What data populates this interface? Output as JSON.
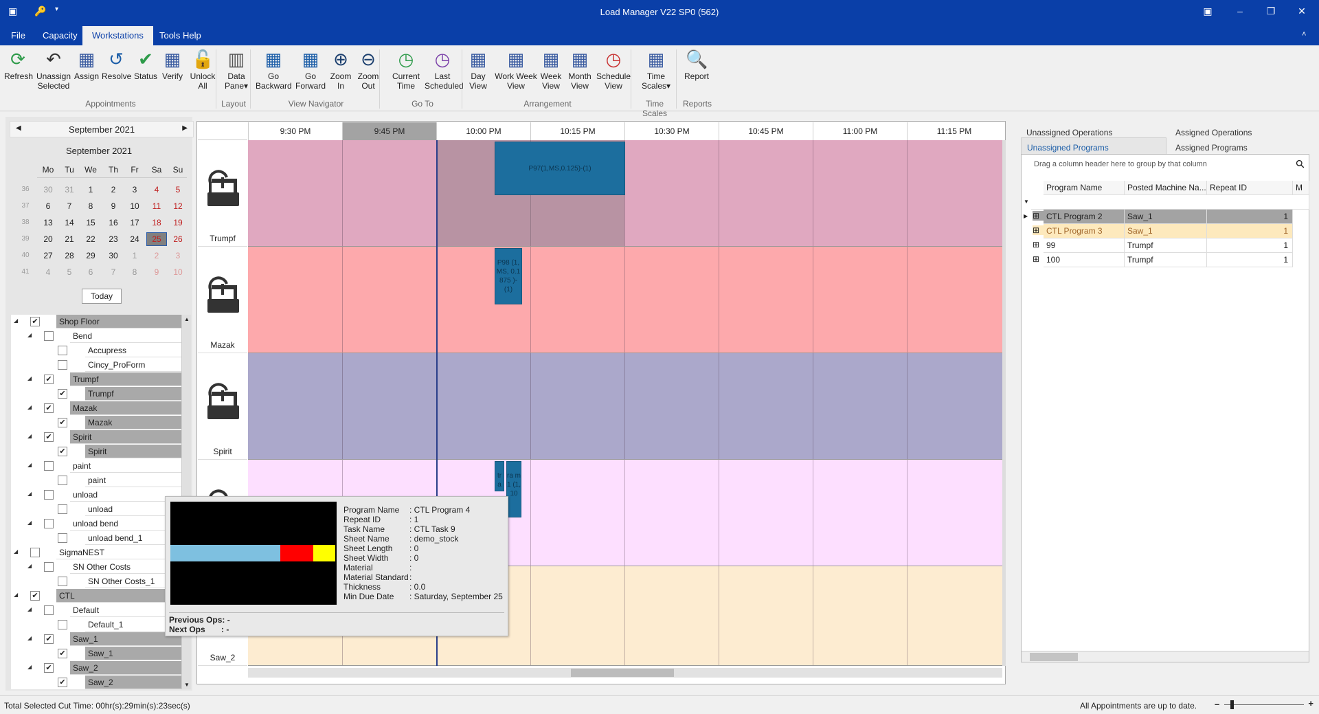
{
  "window": {
    "title": "Load Manager V22 SP0 (562)"
  },
  "menu": [
    "File",
    "Capacity",
    "Workstations",
    "Tools Help"
  ],
  "ribbon": {
    "buttons": [
      {
        "id": "refresh",
        "label": "Refresh",
        "icon": "refresh-icon"
      },
      {
        "id": "unassign",
        "label": "Unassign\nSelected",
        "icon": "undo-icon"
      },
      {
        "id": "assign",
        "label": "Assign",
        "icon": "calendar-bolt-icon"
      },
      {
        "id": "resolve",
        "label": "Resolve",
        "icon": "resolve-icon"
      },
      {
        "id": "status",
        "label": "Status",
        "icon": "check-circle-icon"
      },
      {
        "id": "verify",
        "label": "Verify",
        "icon": "calendar-binoculars-icon"
      },
      {
        "id": "unlock",
        "label": "Unlock\nAll",
        "icon": "unlock-icon"
      },
      {
        "id": "datapane",
        "label": "Data\nPane▾",
        "icon": "pane-icon"
      },
      {
        "id": "gobackward",
        "label": "Go\nBackward",
        "icon": "calendar-back-icon"
      },
      {
        "id": "goforward",
        "label": "Go\nForward",
        "icon": "calendar-forward-icon"
      },
      {
        "id": "zoomin",
        "label": "Zoom\nIn",
        "icon": "zoom-in-icon"
      },
      {
        "id": "zoomout",
        "label": "Zoom\nOut",
        "icon": "zoom-out-icon"
      },
      {
        "id": "currenttime",
        "label": "Current\nTime",
        "icon": "clock-arrow-icon"
      },
      {
        "id": "lastscheduled",
        "label": "Last\nScheduled",
        "icon": "clock-forward-icon"
      },
      {
        "id": "dayview",
        "label": "Day\nView",
        "icon": "calendar-day-icon"
      },
      {
        "id": "workweekview",
        "label": "Work Week\nView",
        "icon": "calendar-workweek-icon"
      },
      {
        "id": "weekview",
        "label": "Week\nView",
        "icon": "calendar-week-icon"
      },
      {
        "id": "monthview",
        "label": "Month\nView",
        "icon": "calendar-month-icon"
      },
      {
        "id": "scheduleview",
        "label": "Schedule\nView",
        "icon": "timeline-clock-icon"
      },
      {
        "id": "timescales",
        "label": "Time\nScales▾",
        "icon": "calendar-clock-icon"
      },
      {
        "id": "report",
        "label": "Report",
        "icon": "report-icon"
      }
    ],
    "groups": [
      "Appointments",
      "Layout",
      "View Navigator",
      "Go To",
      "Arrangement",
      "Time Scales",
      "Reports"
    ]
  },
  "calendar": {
    "nav_title": "September 2021",
    "title": "September 2021",
    "weekdays": [
      "Mo",
      "Tu",
      "We",
      "Th",
      "Fr",
      "Sa",
      "Su"
    ],
    "weeks": [
      {
        "wk": "36",
        "days": [
          "30",
          "31",
          "1",
          "2",
          "3",
          "4",
          "5"
        ]
      },
      {
        "wk": "37",
        "days": [
          "6",
          "7",
          "8",
          "9",
          "10",
          "11",
          "12"
        ]
      },
      {
        "wk": "38",
        "days": [
          "13",
          "14",
          "15",
          "16",
          "17",
          "18",
          "19"
        ]
      },
      {
        "wk": "39",
        "days": [
          "20",
          "21",
          "22",
          "23",
          "24",
          "25",
          "26"
        ]
      },
      {
        "wk": "40",
        "days": [
          "27",
          "28",
          "29",
          "30",
          "1",
          "2",
          "3"
        ]
      },
      {
        "wk": "41",
        "days": [
          "4",
          "5",
          "6",
          "7",
          "8",
          "9",
          "10"
        ]
      }
    ],
    "selected": "25",
    "today_label": "Today"
  },
  "tree": [
    {
      "label": "Shop Floor",
      "level": 0,
      "checked": true,
      "expand": true,
      "sel": true
    },
    {
      "label": "Bend",
      "level": 1,
      "checked": false,
      "expand": true,
      "sel": false
    },
    {
      "label": "Accupress",
      "level": 2,
      "checked": false,
      "expand": false,
      "sel": false
    },
    {
      "label": "Cincy_ProForm",
      "level": 2,
      "checked": false,
      "expand": false,
      "sel": false
    },
    {
      "label": "Trumpf",
      "level": 1,
      "checked": true,
      "expand": true,
      "sel": true
    },
    {
      "label": "Trumpf",
      "level": 2,
      "checked": true,
      "expand": false,
      "sel": true
    },
    {
      "label": "Mazak",
      "level": 1,
      "checked": true,
      "expand": true,
      "sel": true
    },
    {
      "label": "Mazak",
      "level": 2,
      "checked": true,
      "expand": false,
      "sel": true
    },
    {
      "label": "Spirit",
      "level": 1,
      "checked": true,
      "expand": true,
      "sel": true
    },
    {
      "label": "Spirit",
      "level": 2,
      "checked": true,
      "expand": false,
      "sel": true
    },
    {
      "label": "paint",
      "level": 1,
      "checked": false,
      "expand": true,
      "sel": false
    },
    {
      "label": "paint",
      "level": 2,
      "checked": false,
      "expand": false,
      "sel": false
    },
    {
      "label": "unload",
      "level": 1,
      "checked": false,
      "expand": true,
      "sel": false
    },
    {
      "label": "unload",
      "level": 2,
      "checked": false,
      "expand": false,
      "sel": false
    },
    {
      "label": "unload bend",
      "level": 1,
      "checked": false,
      "expand": true,
      "sel": false
    },
    {
      "label": "unload bend_1",
      "level": 2,
      "checked": false,
      "expand": false,
      "sel": false
    },
    {
      "label": "SigmaNEST",
      "level": 0,
      "checked": false,
      "expand": true,
      "sel": false
    },
    {
      "label": "SN Other Costs",
      "level": 1,
      "checked": false,
      "expand": true,
      "sel": false
    },
    {
      "label": "SN Other Costs_1",
      "level": 2,
      "checked": false,
      "expand": false,
      "sel": false
    },
    {
      "label": "CTL",
      "level": 0,
      "checked": true,
      "expand": true,
      "sel": true
    },
    {
      "label": "Default",
      "level": 1,
      "checked": false,
      "expand": true,
      "sel": false
    },
    {
      "label": "Default_1",
      "level": 2,
      "checked": false,
      "expand": false,
      "sel": false
    },
    {
      "label": "Saw_1",
      "level": 1,
      "checked": true,
      "expand": true,
      "sel": true
    },
    {
      "label": "Saw_1",
      "level": 2,
      "checked": true,
      "expand": false,
      "sel": true
    },
    {
      "label": "Saw_2",
      "level": 1,
      "checked": true,
      "expand": true,
      "sel": true
    },
    {
      "label": "Saw_2",
      "level": 2,
      "checked": true,
      "expand": false,
      "sel": true
    }
  ],
  "scheduler": {
    "times": [
      "9:30 PM",
      "9:45 PM",
      "10:00 PM",
      "10:15 PM",
      "10:30 PM",
      "10:45 PM",
      "11:00 PM",
      "11:15 PM"
    ],
    "highlighted_time": "9:45 PM",
    "resources": [
      {
        "name": "Trumpf",
        "color": "#e0a8c0"
      },
      {
        "name": "Mazak",
        "color": "#fda9ac"
      },
      {
        "name": "Spirit",
        "color": "#aba8cb"
      },
      {
        "name": "",
        "color": "#fddfff"
      },
      {
        "name": "Saw_2",
        "color": "#fdecd1"
      }
    ],
    "appointments": [
      {
        "text": "P97(1,MS,0.125)-(1)",
        "lane": 0
      },
      {
        "text": "P98 (1,MS, 0.1875 )-(1)",
        "lane": 1
      },
      {
        "text": "tr a ...",
        "lane": 3
      },
      {
        "text": "ra m 1 (1, 10",
        "lane": 3
      }
    ]
  },
  "tooltip": {
    "fields": [
      {
        "k": "Program Name",
        "v": ": CTL Program 4"
      },
      {
        "k": "Repeat ID",
        "v": ": 1"
      },
      {
        "k": "Task Name",
        "v": ": CTL Task 9"
      },
      {
        "k": "Sheet Name",
        "v": ": demo_stock"
      },
      {
        "k": "Sheet Length",
        "v": ": 0"
      },
      {
        "k": "Sheet Width",
        "v": ": 0"
      },
      {
        "k": "Material",
        "v": ":"
      },
      {
        "k": "Material Standard",
        "v": ":"
      },
      {
        "k": "Thickness",
        "v": ": 0.0"
      },
      {
        "k": "Min Due Date",
        "v": ": Saturday, September 25"
      }
    ],
    "prev_ops": "Previous Ops: -",
    "next_ops": "Next Ops       : -",
    "preview_colors": [
      "#7ec0e0",
      "#ff0000",
      "#ffff00"
    ]
  },
  "rightpanel": {
    "tabs": [
      "Unassigned Operations",
      "Assigned Operations",
      "Unassigned Programs",
      "Assigned Programs"
    ],
    "active_tab": "Unassigned Programs",
    "group_hint": "Drag a column header here to group by that column",
    "columns": [
      "Program Name",
      "Posted Machine Na...",
      "Repeat ID",
      "M"
    ],
    "rows": [
      {
        "name": "CTL Program 2",
        "machine": "Saw_1",
        "repeat": "1",
        "state": "current"
      },
      {
        "name": "CTL Program 3",
        "machine": "Saw_1",
        "repeat": "1",
        "state": "hover"
      },
      {
        "name": "99",
        "machine": "Trumpf",
        "repeat": "1",
        "state": ""
      },
      {
        "name": "100",
        "machine": "Trumpf",
        "repeat": "1",
        "state": ""
      }
    ]
  },
  "status": {
    "left": "Total Selected Cut Time:  00hr(s):29min(s):23sec(s)",
    "right": "All Appointments are up to date.",
    "zoom_fraction": 0.08
  }
}
